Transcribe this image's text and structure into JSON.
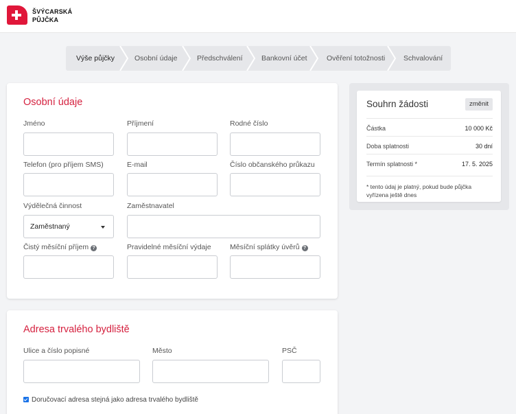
{
  "brand": {
    "line1": "ŠVÝCARSKÁ",
    "line2": "PŮJČKA",
    "accent": "#e0173a"
  },
  "steps": [
    "Výše půjčky",
    "Osobní údaje",
    "Předschválení",
    "Bankovní účet",
    "Ověření totožnosti",
    "Schvalování"
  ],
  "active_step": "Výše půjčky",
  "personal": {
    "title": "Osobní údaje",
    "first_name_label": "Jméno",
    "last_name_label": "Příjmení",
    "birth_number_label": "Rodné číslo",
    "phone_label": "Telefon (pro příjem SMS)",
    "email_label": "E-mail",
    "id_card_label": "Číslo občanského průkazu",
    "occupation_label": "Výdělečná činnost",
    "occupation_value": "Zaměstnaný",
    "employer_label": "Zaměstnavatel",
    "net_income_label": "Čistý měsíční příjem",
    "expenses_label": "Pravidelné měsíční výdaje",
    "loan_payments_label": "Měsíční splátky úvěrů"
  },
  "address": {
    "title": "Adresa trvalého bydliště",
    "street_label": "Ulice a číslo popisné",
    "city_label": "Město",
    "zip_label": "PSČ",
    "same_address_label": "Doručovací adresa stejná jako adresa trvalého bydliště",
    "same_address_checked": true
  },
  "summary": {
    "title": "Souhrn žádosti",
    "change_label": "změnit",
    "rows": [
      {
        "label": "Částka",
        "value": "10 000 Kč"
      },
      {
        "label": "Doba splatnosti",
        "value": "30 dní"
      },
      {
        "label": "Termín splatnosti *",
        "value": "17. 5. 2025"
      }
    ],
    "note": "* tento údaj je platný, pokud bude půjčka vyřízena ještě dnes"
  }
}
